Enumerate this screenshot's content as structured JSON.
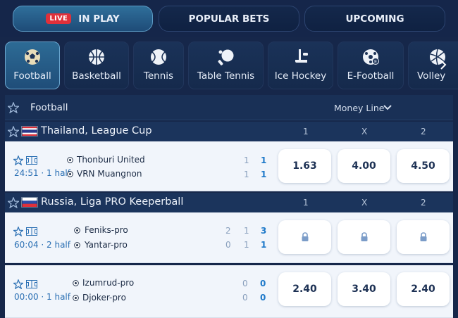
{
  "top_tabs": {
    "live_badge": "LIVE",
    "in_play": "IN PLAY",
    "popular_bets": "POPULAR BETS",
    "upcoming": "UPCOMING"
  },
  "sports": [
    {
      "label": "Football",
      "icon": "football-icon"
    },
    {
      "label": "Basketball",
      "icon": "basketball-icon"
    },
    {
      "label": "Tennis",
      "icon": "tennis-icon"
    },
    {
      "label": "Table Tennis",
      "icon": "table-tennis-icon"
    },
    {
      "label": "Ice Hockey",
      "icon": "ice-hockey-icon"
    },
    {
      "label": "E-Football",
      "icon": "e-football-icon"
    },
    {
      "label": "Volley",
      "icon": "volleyball-icon"
    }
  ],
  "header": {
    "title": "Football",
    "market": "Money Line"
  },
  "columns": [
    "1",
    "X",
    "2"
  ],
  "leagues": [
    {
      "name": "Thailand, League Cup",
      "matches": [
        {
          "time": "24:51 · 1 half",
          "team1": "Thonburi United",
          "team2": "VRN Muangnon",
          "score1": [
            "1",
            "1"
          ],
          "score2": [
            "1",
            "1"
          ],
          "odds": [
            "1.63",
            "4.00",
            "4.50"
          ]
        }
      ]
    },
    {
      "name": "Russia, Liga PRO Keeperball",
      "matches": [
        {
          "time": "60:04 · 2 half",
          "team1": "Feniks-pro",
          "team2": "Yantar-pro",
          "score1": [
            "2",
            "1",
            "3"
          ],
          "score2": [
            "0",
            "1",
            "1"
          ],
          "odds": [
            "locked",
            "locked",
            "locked"
          ]
        },
        {
          "time": "00:00 · 1 half",
          "team1": "Izumrud-pro",
          "team2": "Djoker-pro",
          "score1": [
            "0",
            "0"
          ],
          "score2": [
            "0",
            "0"
          ],
          "odds": [
            "2.40",
            "3.40",
            "2.40"
          ]
        }
      ]
    }
  ],
  "colors": {
    "background": "#16274a",
    "active_tab": "#2f6f9a",
    "live_red": "#e0303a",
    "score_blue": "#1e79c9",
    "row_bg": "#f1f5fb"
  }
}
